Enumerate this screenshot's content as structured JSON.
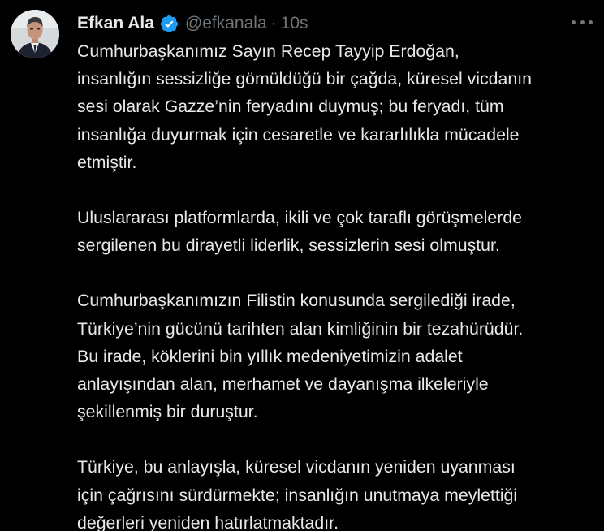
{
  "tweet": {
    "author_name": "Efkan Ala",
    "handle": "@efkanala",
    "separator": "·",
    "timestamp": "10s",
    "verified": true,
    "accent_color": "#1d9bf0",
    "avatar_icon": "profile-photo",
    "more_icon": "more-horizontal-icon",
    "paragraphs": [
      {
        "lines": [
          "Cumhurbaşkanımız Sayın Recep Tayyip Erdoğan,",
          "insanlığın sessizliğe gömüldüğü bir çağda, küresel vicdanın",
          "sesi olarak Gazze’nin feryadını duymuş; bu feryadı, tüm",
          "insanlığa duyurmak için cesaretle ve kararlılıkla mücadele",
          "etmiştir."
        ]
      },
      {
        "lines": [
          "Uluslararası platformlarda, ikili ve çok taraflı görüşmelerde",
          "sergilenen bu dirayetli liderlik, sessizlerin sesi olmuştur."
        ]
      },
      {
        "lines": [
          "Cumhurbaşkanımızın Filistin konusunda sergilediği irade,",
          "Türkiye’nin gücünü tarihten alan kimliğinin bir tezahürüdür.",
          "Bu irade, köklerini bin yıllık medeniyetimizin adalet",
          "anlayışından alan, merhamet ve dayanışma ilkeleriyle",
          "şekillenmiş bir duruştur."
        ]
      },
      {
        "lines": [
          "Türkiye, bu anlayışla, küresel vicdanın yeniden uyanması",
          "için çağrısını sürdürmekte; insanlığın unutmaya meylettiği",
          "değerleri yeniden hatırlatmaktadır."
        ]
      }
    ]
  }
}
